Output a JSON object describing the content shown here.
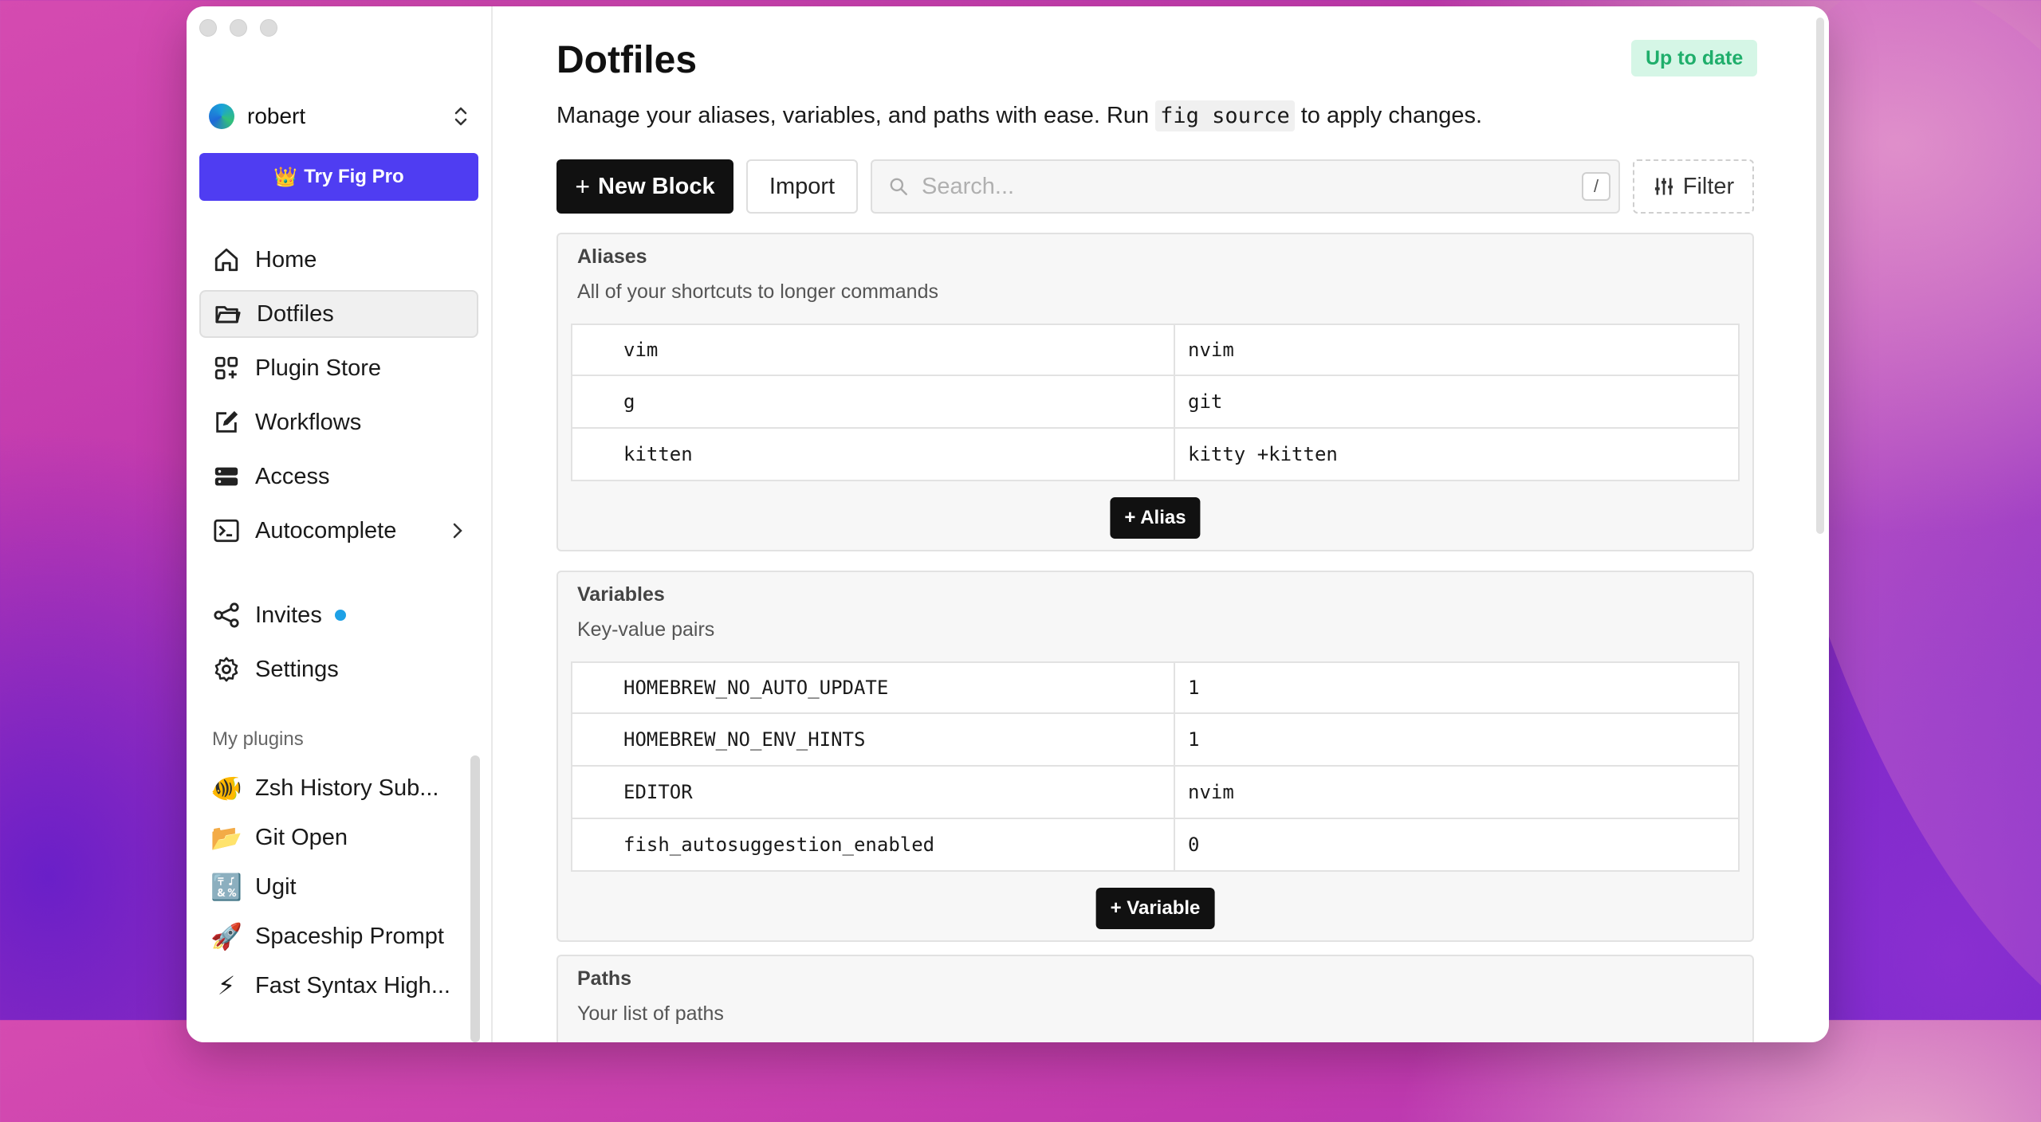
{
  "sidebar": {
    "user": "robert",
    "pro_label": "Try Fig Pro",
    "pro_icon": "👑",
    "nav": [
      {
        "label": "Home",
        "icon": "home-icon"
      },
      {
        "label": "Dotfiles",
        "icon": "folder-icon",
        "active": true
      },
      {
        "label": "Plugin Store",
        "icon": "grid-plus-icon"
      },
      {
        "label": "Workflows",
        "icon": "edit-icon"
      },
      {
        "label": "Access",
        "icon": "server-icon"
      },
      {
        "label": "Autocomplete",
        "icon": "terminal-icon"
      }
    ],
    "nav2": [
      {
        "label": "Invites",
        "icon": "share-icon"
      },
      {
        "label": "Settings",
        "icon": "gear-icon"
      }
    ],
    "plugins_title": "My plugins",
    "plugins": [
      {
        "label": "Zsh History Sub...",
        "icon": "🐠"
      },
      {
        "label": "Git Open",
        "icon": "📂"
      },
      {
        "label": "Ugit",
        "icon": "🔣"
      },
      {
        "label": "Spaceship Prompt",
        "icon": "🚀"
      },
      {
        "label": "Fast Syntax High...",
        "icon": "⚡"
      }
    ]
  },
  "main": {
    "title": "Dotfiles",
    "status": "Up to date",
    "description_before": "Manage your aliases, variables, and paths with ease. Run",
    "description_code": "fig source",
    "description_after": "to apply changes.",
    "new_block_label": "New Block",
    "import_label": "Import",
    "search_placeholder": "Search...",
    "search_shortcut": "/",
    "filter_label": "Filter",
    "aliases": {
      "title": "Aliases",
      "subtitle": "All of your shortcuts to longer commands",
      "rows": [
        {
          "key": "vim",
          "value": "nvim"
        },
        {
          "key": "g",
          "value": "git"
        },
        {
          "key": "kitten",
          "value": "kitty +kitten"
        }
      ],
      "add_label": "+ Alias"
    },
    "variables": {
      "title": "Variables",
      "subtitle": "Key-value pairs",
      "rows": [
        {
          "key": "HOMEBREW_NO_AUTO_UPDATE",
          "value": "1"
        },
        {
          "key": "HOMEBREW_NO_ENV_HINTS",
          "value": "1"
        },
        {
          "key": "EDITOR",
          "value": "nvim"
        },
        {
          "key": "fish_autosuggestion_enabled",
          "value": "0"
        }
      ],
      "add_label": "+ Variable"
    },
    "paths": {
      "title": "Paths",
      "subtitle": "Your list of paths"
    }
  },
  "colors": {
    "accent": "#4f3df2",
    "status_bg": "#d5f6e6",
    "status_text": "#1fae6b",
    "invite_dot": "#1ea1e6"
  }
}
